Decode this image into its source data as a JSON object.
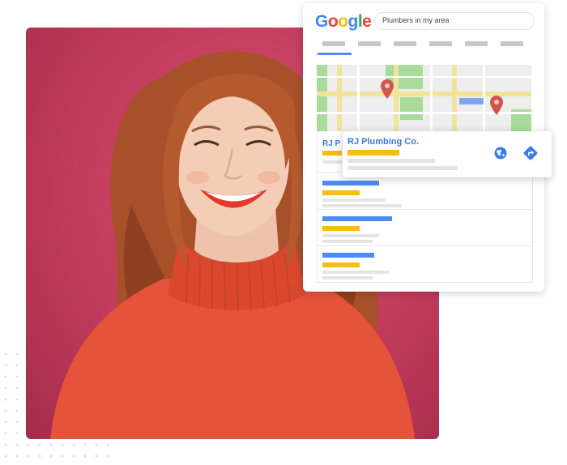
{
  "google": {
    "logo_letters": [
      {
        "char": "G",
        "color": "#4285F4"
      },
      {
        "char": "o",
        "color": "#EA4335"
      },
      {
        "char": "o",
        "color": "#FBBC05"
      },
      {
        "char": "g",
        "color": "#4285F4"
      },
      {
        "char": "l",
        "color": "#34A853"
      },
      {
        "char": "e",
        "color": "#EA4335"
      }
    ],
    "search_query": "Plumbers in my area"
  },
  "results": {
    "partial_title": "RJ P"
  },
  "popup": {
    "business_name": "RJ Plumbing Co.",
    "website_icon": "globe-icon",
    "directions_icon": "directions-icon"
  },
  "colors": {
    "photo_background": "#c23b5c",
    "sweater": "#e4533a",
    "accent_blue": "#4d8cf5",
    "accent_yellow": "#f9bc10",
    "map_green": "#a9dc9b",
    "map_road": "#f2e39a",
    "pin_red": "#d0564b"
  }
}
